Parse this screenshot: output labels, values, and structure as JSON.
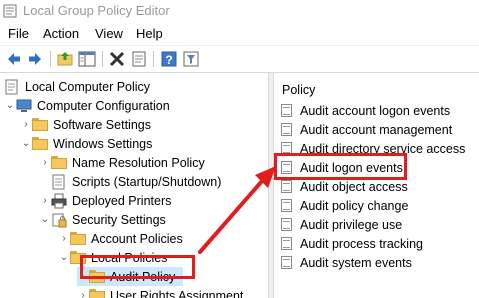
{
  "window": {
    "title": "Local Group Policy Editor"
  },
  "menu": [
    "File",
    "Action",
    "View",
    "Help"
  ],
  "toolbar": {
    "buttons": [
      "back-icon",
      "forward-icon",
      "up-folder-icon",
      "show-hide-tree-icon",
      "delete-icon",
      "properties-icon",
      "help-icon",
      "filter-icon"
    ]
  },
  "tree": {
    "root": "Local Computer Policy",
    "computer_configuration": "Computer Configuration",
    "software_settings": "Software Settings",
    "windows_settings": "Windows Settings",
    "name_resolution_policy": "Name Resolution Policy",
    "scripts": "Scripts (Startup/Shutdown)",
    "deployed_printers": "Deployed Printers",
    "security_settings": "Security Settings",
    "account_policies": "Account Policies",
    "local_policies": "Local Policies",
    "audit_policy": "Audit Policy",
    "user_rights_assignment": "User Rights Assignment"
  },
  "list": {
    "header": "Policy",
    "items": [
      "Audit account logon events",
      "Audit account management",
      "Audit directory service access",
      "Audit logon events",
      "Audit object access",
      "Audit policy change",
      "Audit privilege use",
      "Audit process tracking",
      "Audit system events"
    ]
  },
  "colors": {
    "highlight": "#e11d1d",
    "selection": "#cce8ff",
    "folder": "#f3c95e"
  }
}
